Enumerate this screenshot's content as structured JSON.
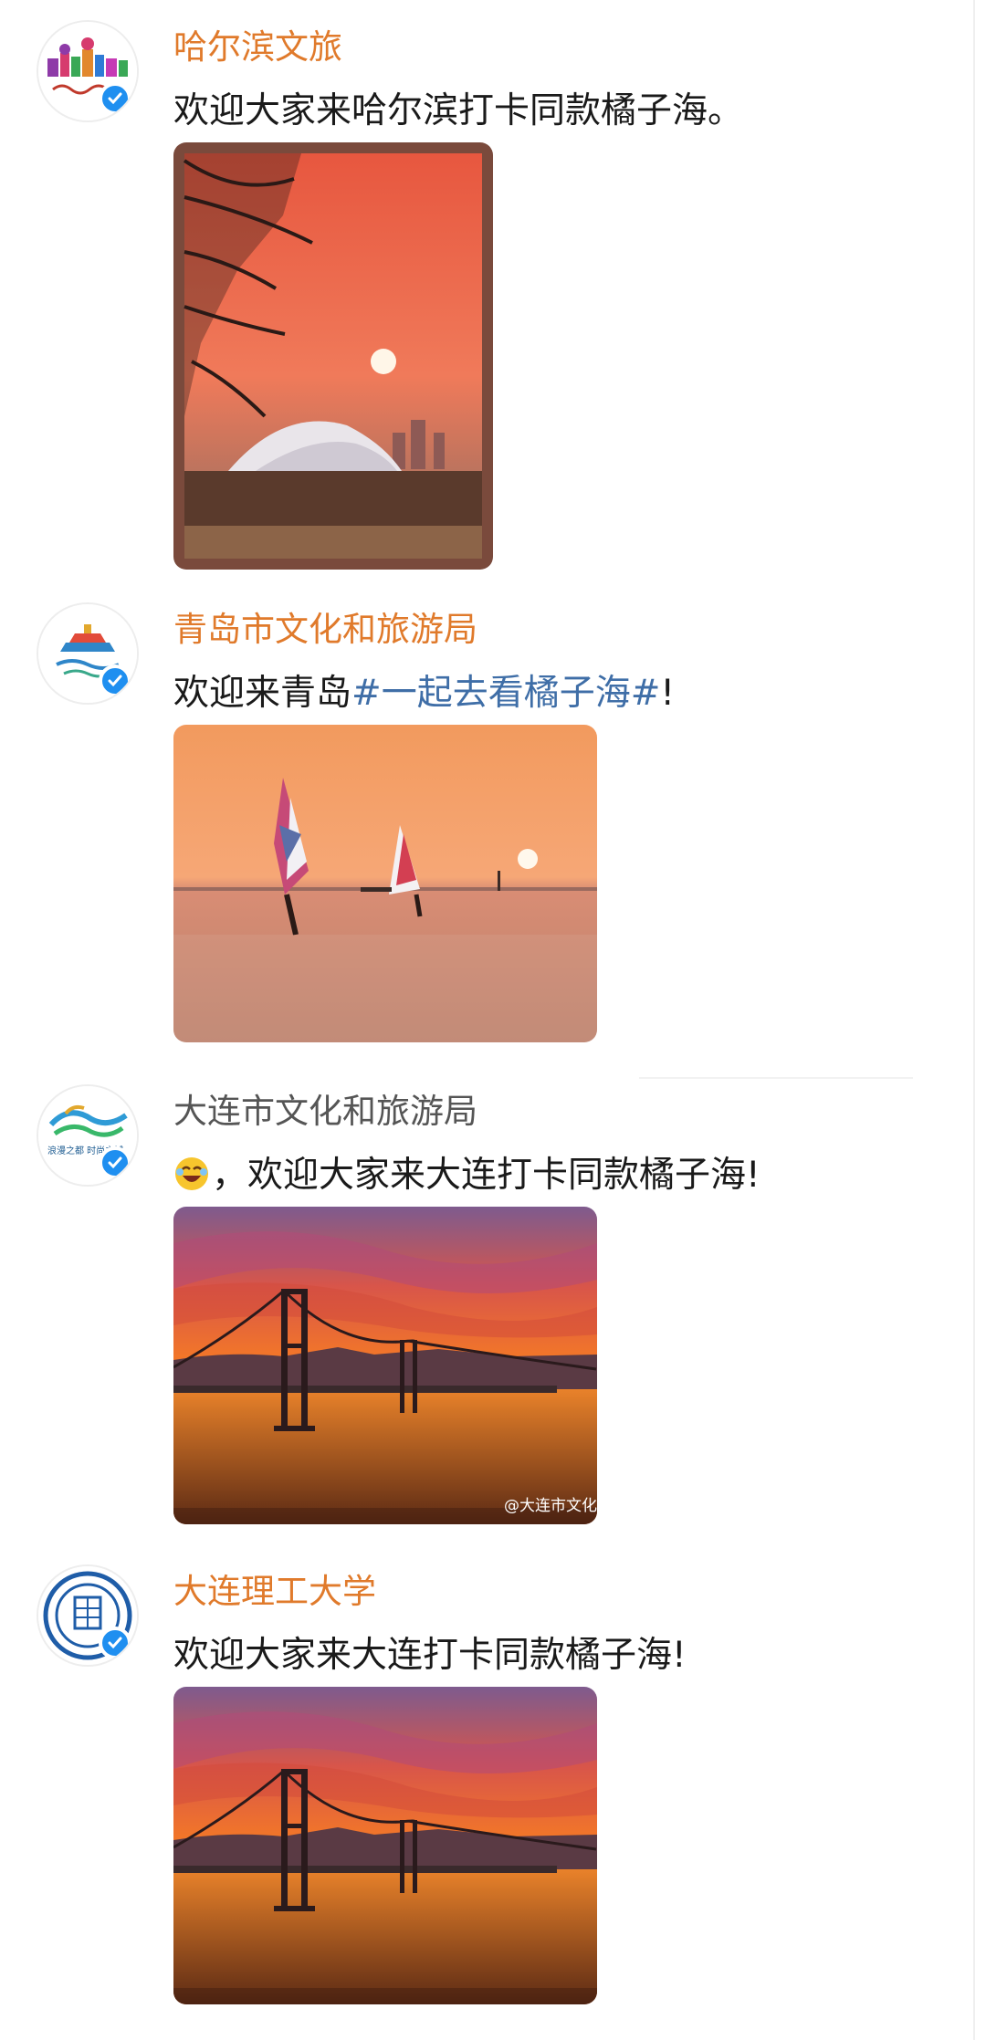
{
  "posts": [
    {
      "account": "哈尔滨文旅",
      "name_color": "#e07a2b",
      "avatar_icon": "harbin-culture-logo-icon",
      "verified": true,
      "text": "欢迎大家来哈尔滨打卡同款橘子海。",
      "photo": "harbin-opera-house-sunset-photo"
    },
    {
      "account": "青岛市文化和旅游局",
      "name_color": "#e07a2b",
      "avatar_icon": "qingdao-culture-logo-icon",
      "verified": true,
      "text_prefix": "欢迎来青岛",
      "hashtag": "#一起去看橘子海#",
      "text_suffix": "!",
      "photo": "qingdao-windsurf-sunset-photo"
    },
    {
      "account": "大连市文化和旅游局",
      "name_color": "#555555",
      "avatar_icon": "dalian-culture-logo-icon",
      "avatar_subtext": "浪漫之都 时尚之城",
      "verified": true,
      "emoji": "laughing-emoji",
      "text": "，欢迎大家来大连打卡同款橘子海!",
      "photo": "dalian-bridge-sunset-photo",
      "watermark": "@大连市文化"
    },
    {
      "account": "大连理工大学",
      "name_color": "#e07a2b",
      "avatar_icon": "dalian-university-of-technology-seal-icon",
      "verified": true,
      "text": "欢迎大家来大连打卡同款橘子海!",
      "photo": "dalian-bridge-sunset-photo"
    }
  ],
  "colors": {
    "accent_name": "#e07a2b",
    "hashtag": "#3f6ea7",
    "verified_badge": "#1f8ff0"
  }
}
